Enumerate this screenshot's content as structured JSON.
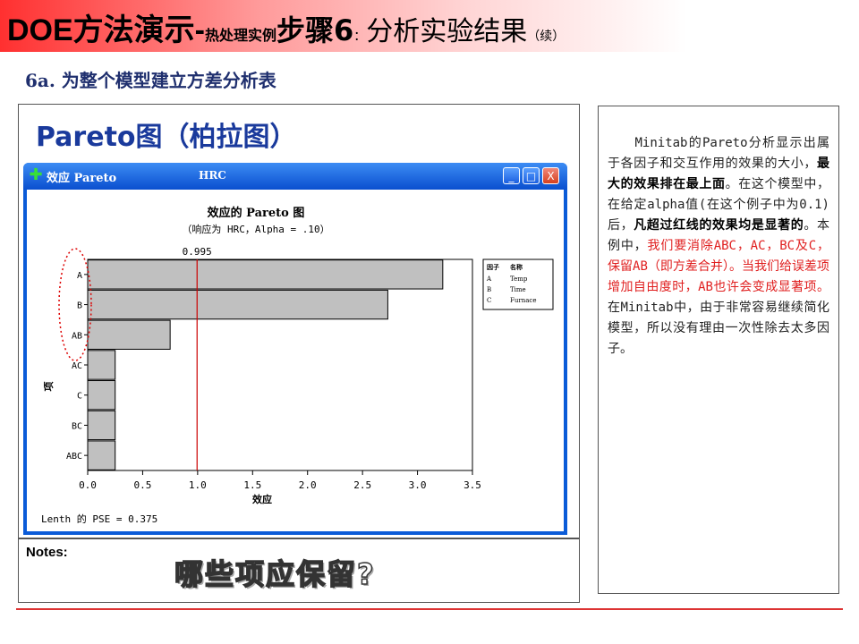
{
  "slide": {
    "title_main": "DOE方法演示-",
    "title_small": "热处理实例",
    "title_step": "步骤6",
    "title_colon": "：",
    "title_rest": "分析实验结果",
    "title_cont": "（续）",
    "subtitle": "6a. 为整个模型建立方差分析表",
    "pareto_heading": "Pareto图（柏拉图）"
  },
  "window": {
    "title": "效应 Pareto",
    "title_extra": "HRC",
    "buttons": {
      "minimize": "_",
      "maximize": "□",
      "close": "X"
    }
  },
  "chart_data": {
    "type": "bar",
    "orientation": "horizontal",
    "title": "效应的 Pareto 图",
    "subtitle": "（响应为 HRC，Alpha = .10）",
    "xlabel": "效应",
    "ylabel": "项",
    "categories": [
      "A",
      "B",
      "AB",
      "AC",
      "C",
      "BC",
      "ABC"
    ],
    "values": [
      3.23,
      2.73,
      0.75,
      0.25,
      0.25,
      0.25,
      0.25
    ],
    "reference_line": {
      "value": 0.995,
      "label": "0.995",
      "color": "#cc0000"
    },
    "xlim": [
      0.0,
      3.5
    ],
    "xticks": [
      "0.0",
      "0.5",
      "1.0",
      "1.5",
      "2.0",
      "2.5",
      "3.0",
      "3.5"
    ],
    "xtick_values": [
      0,
      0.5,
      1.0,
      1.5,
      2.0,
      2.5,
      3.0,
      3.5
    ],
    "legend": {
      "header": [
        "因子",
        "名称"
      ],
      "rows": [
        [
          "A",
          "Temp"
        ],
        [
          "B",
          "Time"
        ],
        [
          "C",
          "Furnace"
        ]
      ],
      "placement": "top-right"
    },
    "highlight": [
      "A",
      "B",
      "AB"
    ],
    "bar_color": "#c0c0c0",
    "grid": false
  },
  "lenth_note": "Lenth 的 PSE = 0.375",
  "notes": {
    "label": "Notes:",
    "question": "哪些项应保留?"
  },
  "explanation": [
    {
      "text": "　　Minitab的Pareto分析显示出属于各因子和交互作用的效果的大小，",
      "style": "n"
    },
    {
      "text": "最大的效果排在最上面",
      "style": "b"
    },
    {
      "text": "。在这个模型中，在给定alpha值(在这个例子中为0.1)后，",
      "style": "n"
    },
    {
      "text": "凡超过红线的效果均是显著的",
      "style": "b"
    },
    {
      "text": "。本例中，",
      "style": "n"
    },
    {
      "text": "我们要消除ABC，AC，BC及C，保留AB（即方差合并）",
      "style": "r"
    },
    {
      "text": "。当我们给误差项增加自由度时，AB也许会变成显著项。",
      "style": "r"
    },
    {
      "text": "在Minitab中，由于非常容易继续简化模型，所以没有理由一次性除去太多因子。",
      "style": "n"
    }
  ],
  "colors": {
    "header_red": "#ff3030",
    "title_blue": "#1a3a9c",
    "xp_blue": "#0a5bd8",
    "emphasis_red": "#e02020"
  }
}
